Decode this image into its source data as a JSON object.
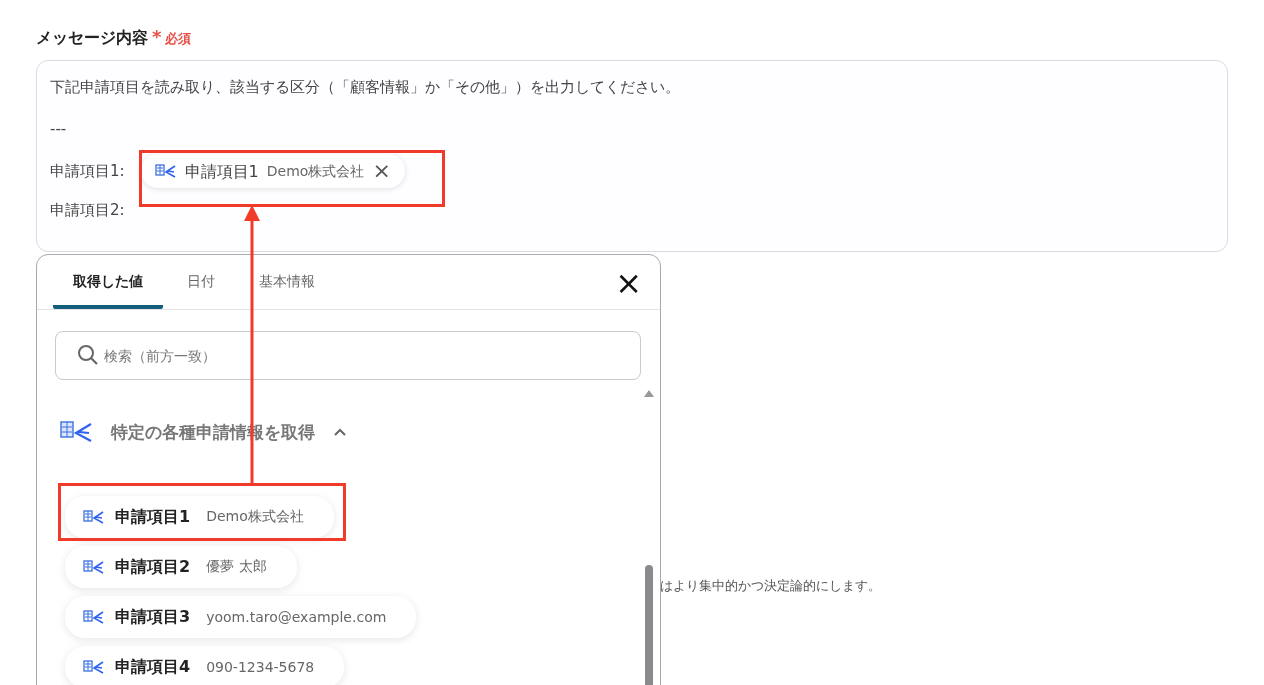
{
  "field": {
    "label": "メッセージ内容",
    "required_mark": "*",
    "required_text": "必須",
    "lines": [
      {
        "kind": "text",
        "text": "下記申請項目を読み取り、該当する区分（「顧客情報」か「その他」）を出力してください。"
      },
      {
        "kind": "text",
        "text": "---"
      },
      {
        "kind": "variable",
        "text": "申請項目1:",
        "chip": {
          "name": "申請項目1",
          "value": "Demo株式会社",
          "remove": "×"
        }
      },
      {
        "kind": "text",
        "text": "申請項目2:"
      }
    ]
  },
  "picker": {
    "tabs": [
      {
        "label": "取得した値",
        "selected": true
      },
      {
        "label": "日付",
        "selected": false
      },
      {
        "label": "基本情報",
        "selected": false
      }
    ],
    "close": "×",
    "search": {
      "placeholder": "検索（前方一致）"
    },
    "group": {
      "title": "特定の各種申請情報を取得",
      "expanded": true,
      "items": [
        {
          "name": "申請項目1",
          "value": "Demo株式会社"
        },
        {
          "name": "申請項目2",
          "value": "優夢 太郎"
        },
        {
          "name": "申請項目3",
          "value": "yoom.taro@example.com"
        },
        {
          "name": "申請項目4",
          "value": "090-1234-5678"
        }
      ]
    }
  },
  "background_note": "はより集中的かつ決定論的にします。"
}
